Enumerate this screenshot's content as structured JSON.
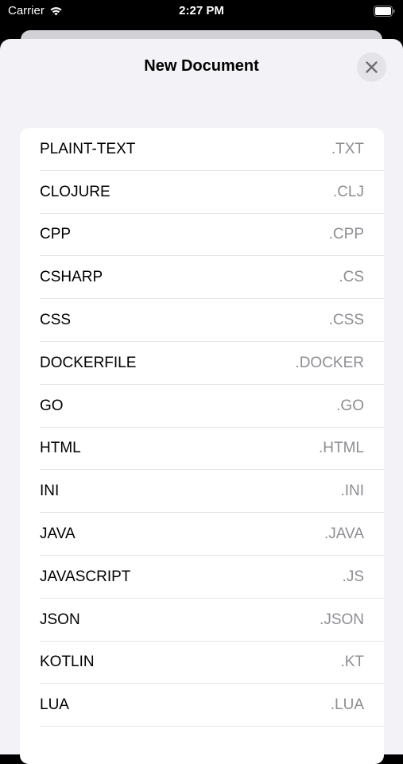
{
  "status_bar": {
    "carrier": "Carrier",
    "time": "2:27 PM",
    "icons": [
      "wifi-icon",
      "battery-icon"
    ]
  },
  "sheet": {
    "title": "New Document",
    "close_icon": "close-icon"
  },
  "file_types": [
    {
      "name": "PLAINT-TEXT",
      "ext": ".TXT"
    },
    {
      "name": "CLOJURE",
      "ext": ".CLJ"
    },
    {
      "name": "CPP",
      "ext": ".CPP"
    },
    {
      "name": "CSHARP",
      "ext": ".CS"
    },
    {
      "name": "CSS",
      "ext": ".CSS"
    },
    {
      "name": "DOCKERFILE",
      "ext": ".DOCKER"
    },
    {
      "name": "GO",
      "ext": ".GO"
    },
    {
      "name": "HTML",
      "ext": ".HTML"
    },
    {
      "name": "INI",
      "ext": ".INI"
    },
    {
      "name": "JAVA",
      "ext": ".JAVA"
    },
    {
      "name": "JAVASCRIPT",
      "ext": ".JS"
    },
    {
      "name": "JSON",
      "ext": ".JSON"
    },
    {
      "name": "KOTLIN",
      "ext": ".KT"
    },
    {
      "name": "LUA",
      "ext": ".LUA"
    }
  ],
  "colors": {
    "background": "#f2f2f7",
    "secondary_text": "#8e8e93",
    "separator": "#e4e4e8"
  }
}
